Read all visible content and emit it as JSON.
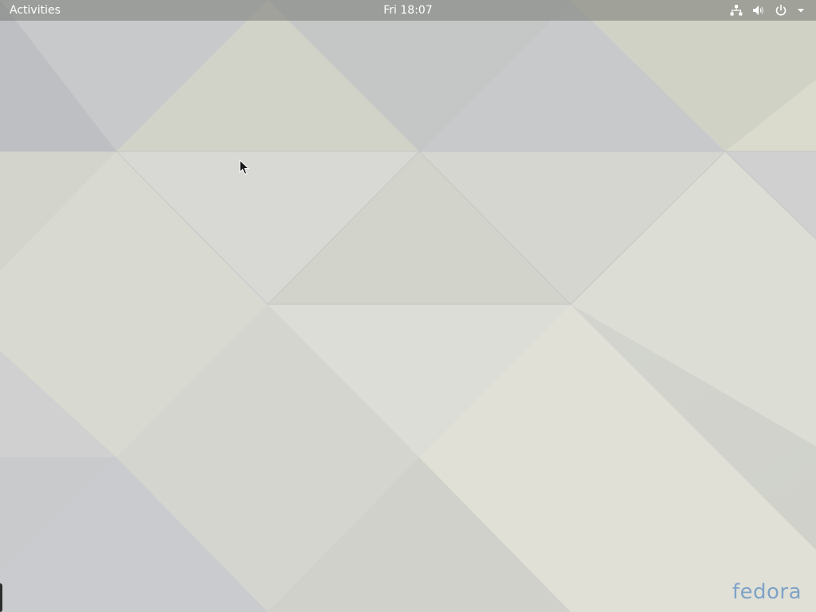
{
  "topbar": {
    "activities_label": "Activities",
    "clock": "Fri 18:07"
  },
  "system_tray": {
    "icons": [
      "network-wired-icon",
      "volume-icon",
      "power-icon",
      "dropdown-arrow-icon"
    ]
  },
  "desktop": {
    "logo_text": "fedora"
  },
  "colors": {
    "topbar": "#787a76",
    "topbar_text": "#ffffff",
    "wallpaper_base": "#d6d6d0",
    "logo": "#7fa3c7"
  }
}
